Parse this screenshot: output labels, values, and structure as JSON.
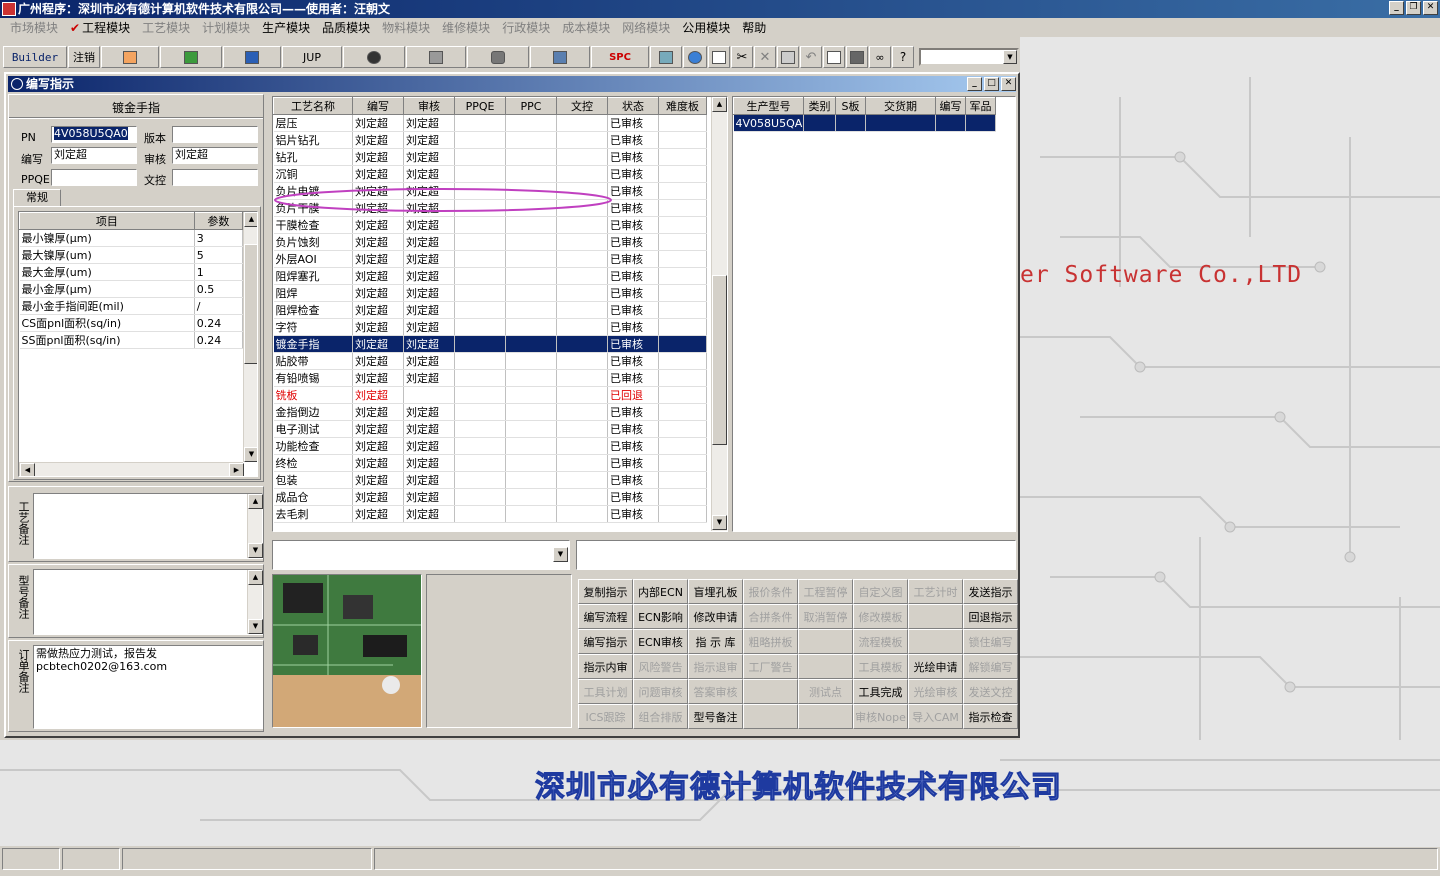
{
  "app": {
    "title": "广州程序：深圳市必有德计算机软件技术有限公司——使用者：汪朝文",
    "background_slogan": "er Software Co.,LTD",
    "background_company": "深圳市必有德计算机软件技术有限公司"
  },
  "menu": [
    {
      "label": "市场模块",
      "enabled": false
    },
    {
      "label": "工程模块",
      "enabled": true,
      "checked": true
    },
    {
      "label": "工艺模块",
      "enabled": false
    },
    {
      "label": "计划模块",
      "enabled": false
    },
    {
      "label": "生产模块",
      "enabled": true
    },
    {
      "label": "品质模块",
      "enabled": true
    },
    {
      "label": "物料模块",
      "enabled": false
    },
    {
      "label": "维修模块",
      "enabled": false
    },
    {
      "label": "行政模块",
      "enabled": false
    },
    {
      "label": "成本模块",
      "enabled": false
    },
    {
      "label": "网络模块",
      "enabled": false
    },
    {
      "label": "公用模块",
      "enabled": true
    },
    {
      "label": "帮助",
      "enabled": true
    }
  ],
  "toolbar": {
    "builder_label": "Builder",
    "logout_label": "注销",
    "jup_label": "JUP",
    "spc_label": "SPC"
  },
  "child": {
    "title": "编写指示",
    "section_title": "镀金手指",
    "form": {
      "pn_label": "PN",
      "pn_value": "4V058U5QA0",
      "version_label": "版本",
      "version_value": "",
      "writer_label": "编写",
      "writer_value": "刘定超",
      "reviewer_label": "审核",
      "reviewer_value": "刘定超",
      "ppqe_label": "PPQE",
      "ppqe_value": "",
      "wenkong_label": "文控",
      "wenkong_value": ""
    },
    "tab_label": "常规",
    "params": {
      "headers": [
        "项目",
        "参数"
      ],
      "rows": [
        [
          "最小镍厚(μm)",
          "3"
        ],
        [
          "最大镍厚(um)",
          "5"
        ],
        [
          "最大金厚(um)",
          "1"
        ],
        [
          "最小金厚(μm)",
          "0.5"
        ],
        [
          "最小金手指间距(mil)",
          "/"
        ],
        [
          "CS面pnl面积(sq/in)",
          "0.24"
        ],
        [
          "SS面pnl面积(sq/in)",
          "0.24"
        ]
      ]
    },
    "notes": {
      "process_label": "工艺备注",
      "model_label": "型号备注",
      "order_label": "订单备注",
      "order_text": "需做热应力测试，报告发\npcbtech0202@163.com"
    },
    "process": {
      "headers": [
        "工艺名称",
        "编写",
        "审核",
        "PPQE",
        "PPC",
        "文控",
        "状态",
        "难度板"
      ],
      "rows": [
        [
          "层压",
          "刘定超",
          "刘定超",
          "",
          "",
          "",
          "已审核",
          ""
        ],
        [
          "铝片钻孔",
          "刘定超",
          "刘定超",
          "",
          "",
          "",
          "已审核",
          ""
        ],
        [
          "钻孔",
          "刘定超",
          "刘定超",
          "",
          "",
          "",
          "已审核",
          ""
        ],
        [
          "沉铜",
          "刘定超",
          "刘定超",
          "",
          "",
          "",
          "已审核",
          ""
        ],
        [
          "负片电镀",
          "刘定超",
          "刘定超",
          "",
          "",
          "",
          "已审核",
          ""
        ],
        [
          "负片干膜",
          "刘定超",
          "刘定超",
          "",
          "",
          "",
          "已审核",
          ""
        ],
        [
          "干膜检查",
          "刘定超",
          "刘定超",
          "",
          "",
          "",
          "已审核",
          ""
        ],
        [
          "负片蚀刻",
          "刘定超",
          "刘定超",
          "",
          "",
          "",
          "已审核",
          ""
        ],
        [
          "外层AOI",
          "刘定超",
          "刘定超",
          "",
          "",
          "",
          "已审核",
          ""
        ],
        [
          "阻焊塞孔",
          "刘定超",
          "刘定超",
          "",
          "",
          "",
          "已审核",
          ""
        ],
        [
          "阻焊",
          "刘定超",
          "刘定超",
          "",
          "",
          "",
          "已审核",
          ""
        ],
        [
          "阻焊检查",
          "刘定超",
          "刘定超",
          "",
          "",
          "",
          "已审核",
          ""
        ],
        [
          "字符",
          "刘定超",
          "刘定超",
          "",
          "",
          "",
          "已审核",
          ""
        ],
        [
          "镀金手指",
          "刘定超",
          "刘定超",
          "",
          "",
          "",
          "已审核",
          ""
        ],
        [
          "贴胶带",
          "刘定超",
          "刘定超",
          "",
          "",
          "",
          "已审核",
          ""
        ],
        [
          "有铅喷锡",
          "刘定超",
          "刘定超",
          "",
          "",
          "",
          "已审核",
          ""
        ],
        [
          "铣板",
          "刘定超",
          "",
          "",
          "",
          "",
          "已回退",
          ""
        ],
        [
          "金指倒边",
          "刘定超",
          "刘定超",
          "",
          "",
          "",
          "已审核",
          ""
        ],
        [
          "电子测试",
          "刘定超",
          "刘定超",
          "",
          "",
          "",
          "已审核",
          ""
        ],
        [
          "功能检查",
          "刘定超",
          "刘定超",
          "",
          "",
          "",
          "已审核",
          ""
        ],
        [
          "终检",
          "刘定超",
          "刘定超",
          "",
          "",
          "",
          "已审核",
          ""
        ],
        [
          "包装",
          "刘定超",
          "刘定超",
          "",
          "",
          "",
          "已审核",
          ""
        ],
        [
          "成品仓",
          "刘定超",
          "刘定超",
          "",
          "",
          "",
          "已审核",
          ""
        ],
        [
          "去毛刺",
          "刘定超",
          "刘定超",
          "",
          "",
          "",
          "已审核",
          ""
        ]
      ],
      "selected_row": 13,
      "reverted_row": 16
    },
    "models": {
      "headers": [
        "生产型号",
        "类别",
        "S板",
        "交货期",
        "编写",
        "军品"
      ],
      "rows": [
        [
          "4V058U5QA0",
          "",
          "",
          "",
          "",
          ""
        ]
      ]
    },
    "buttons": [
      {
        "label": "复制指示",
        "enabled": true
      },
      {
        "label": "内部ECN",
        "enabled": true
      },
      {
        "label": "盲埋孔板",
        "enabled": true
      },
      {
        "label": "报价条件",
        "enabled": false
      },
      {
        "label": "工程暂停",
        "enabled": false
      },
      {
        "label": "自定义图",
        "enabled": false
      },
      {
        "label": "工艺计时",
        "enabled": false
      },
      {
        "label": "发送指示",
        "enabled": true
      },
      {
        "label": "编写流程",
        "enabled": true
      },
      {
        "label": "ECN影响",
        "enabled": true
      },
      {
        "label": "修改申请",
        "enabled": true
      },
      {
        "label": "合拼条件",
        "enabled": false
      },
      {
        "label": "取消暂停",
        "enabled": false
      },
      {
        "label": "修改模板",
        "enabled": false
      },
      {
        "label": "",
        "enabled": false
      },
      {
        "label": "回退指示",
        "enabled": true
      },
      {
        "label": "编写指示",
        "enabled": true
      },
      {
        "label": "ECN审核",
        "enabled": true
      },
      {
        "label": "指 示 库",
        "enabled": true
      },
      {
        "label": "粗略拼板",
        "enabled": false
      },
      {
        "label": "",
        "enabled": false
      },
      {
        "label": "流程模板",
        "enabled": false
      },
      {
        "label": "",
        "enabled": false
      },
      {
        "label": "锁住编写",
        "enabled": false
      },
      {
        "label": "指示内审",
        "enabled": true
      },
      {
        "label": "风险警告",
        "enabled": false
      },
      {
        "label": "指示退审",
        "enabled": false
      },
      {
        "label": "工厂警告",
        "enabled": false
      },
      {
        "label": "",
        "enabled": false
      },
      {
        "label": "工具模板",
        "enabled": false
      },
      {
        "label": "光绘申请",
        "enabled": true
      },
      {
        "label": "解锁编写",
        "enabled": false
      },
      {
        "label": "工具计划",
        "enabled": false
      },
      {
        "label": "问题审核",
        "enabled": false
      },
      {
        "label": "答案审核",
        "enabled": false
      },
      {
        "label": "",
        "enabled": false
      },
      {
        "label": "测试点",
        "enabled": false
      },
      {
        "label": "工具完成",
        "enabled": true
      },
      {
        "label": "光绘审核",
        "enabled": false
      },
      {
        "label": "发送文控",
        "enabled": false
      },
      {
        "label": "ICS跟踪",
        "enabled": false
      },
      {
        "label": "组合排版",
        "enabled": false
      },
      {
        "label": "型号备注",
        "enabled": true
      },
      {
        "label": "",
        "enabled": false
      },
      {
        "label": "",
        "enabled": false
      },
      {
        "label": "审核Nope",
        "enabled": false
      },
      {
        "label": "导入CAM",
        "enabled": false
      },
      {
        "label": "指示检查",
        "enabled": true
      }
    ]
  },
  "colors": {
    "title_start": "#0a246a",
    "selection": "#0a246a",
    "reverted": "#e00000",
    "annotation": "#c040c0"
  }
}
